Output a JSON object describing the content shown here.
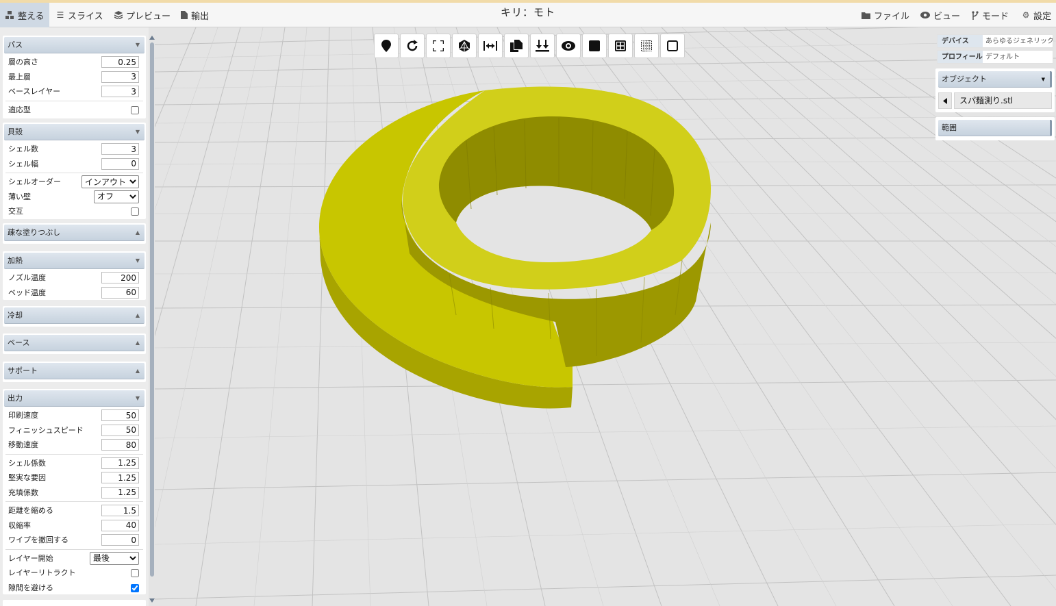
{
  "app_title": "キリ：モト",
  "menu": {
    "arrange": "整える",
    "slice": "スライス",
    "preview": "プレビュー",
    "export": "輸出",
    "file": "ファイル",
    "view": "ビュー",
    "mode": "モード",
    "settings": "設定"
  },
  "toolbar": {
    "buttons": [
      "map-marker-icon",
      "rotate-icon",
      "fullscreen-icon",
      "polyhedron-icon",
      "fit-width-icon",
      "copy-icon",
      "drop-to-bed-icon",
      "eye-icon",
      "solid-square-icon",
      "grid-icon",
      "dotted-grid-icon",
      "square-outline-icon"
    ]
  },
  "left": {
    "path": {
      "title": "パス",
      "layer_height_label": "層の高さ",
      "layer_height": "0.25",
      "top_layers_label": "最上層",
      "top_layers": "3",
      "base_layers_label": "ベースレイヤー",
      "base_layers": "3",
      "adaptive_label": "適応型",
      "adaptive": false
    },
    "shell": {
      "title": "貝殻",
      "shell_count_label": "シェル数",
      "shell_count": "3",
      "shell_width_label": "シェル幅",
      "shell_width": "0",
      "shell_order_label": "シェルオーダー",
      "shell_order": "インアウト",
      "thin_wall_label": "薄い壁",
      "thin_wall": "オフ",
      "alternate_label": "交互",
      "alternate": false
    },
    "sparse_infill": {
      "title": "疎な塗りつぶし"
    },
    "heat": {
      "title": "加熱",
      "nozzle_label": "ノズル温度",
      "nozzle": "200",
      "bed_label": "ベッド温度",
      "bed": "60"
    },
    "cooling": {
      "title": "冷却"
    },
    "base": {
      "title": "ベース"
    },
    "support": {
      "title": "サポート"
    },
    "output": {
      "title": "出力",
      "print_speed_label": "印刷速度",
      "print_speed": "50",
      "finish_speed_label": "フィニッシュスピード",
      "finish_speed": "50",
      "move_speed_label": "移動速度",
      "move_speed": "80",
      "shell_factor_label": "シェル係数",
      "shell_factor": "1.25",
      "solid_factor_label": "堅実な要因",
      "solid_factor": "1.25",
      "fill_factor_label": "充填係数",
      "fill_factor": "1.25",
      "shorten_label": "距離を縮める",
      "shorten": "1.5",
      "shrink_label": "収縮率",
      "shrink": "40",
      "wipe_label": "ワイプを撤回する",
      "wipe": "0",
      "layer_start_label": "レイヤー開始",
      "layer_start": "最後",
      "layer_retract_label": "レイヤーリトラクト",
      "layer_retract": false,
      "avoid_gaps_label": "隙間を避ける",
      "avoid_gaps": true
    }
  },
  "right": {
    "device_label": "デバイス",
    "device": "あらゆるジェネリックマ",
    "profile_label": "プロフィール",
    "profile": "デフォルト",
    "objects_title": "オブジェクト",
    "object_file": "スパ麺測り.stl",
    "range_title": "範囲"
  },
  "colors": {
    "model_top": "#c8c600",
    "model_side": "#9a9600",
    "grid": "#bfbfbf",
    "background": "#e4e4e4"
  }
}
